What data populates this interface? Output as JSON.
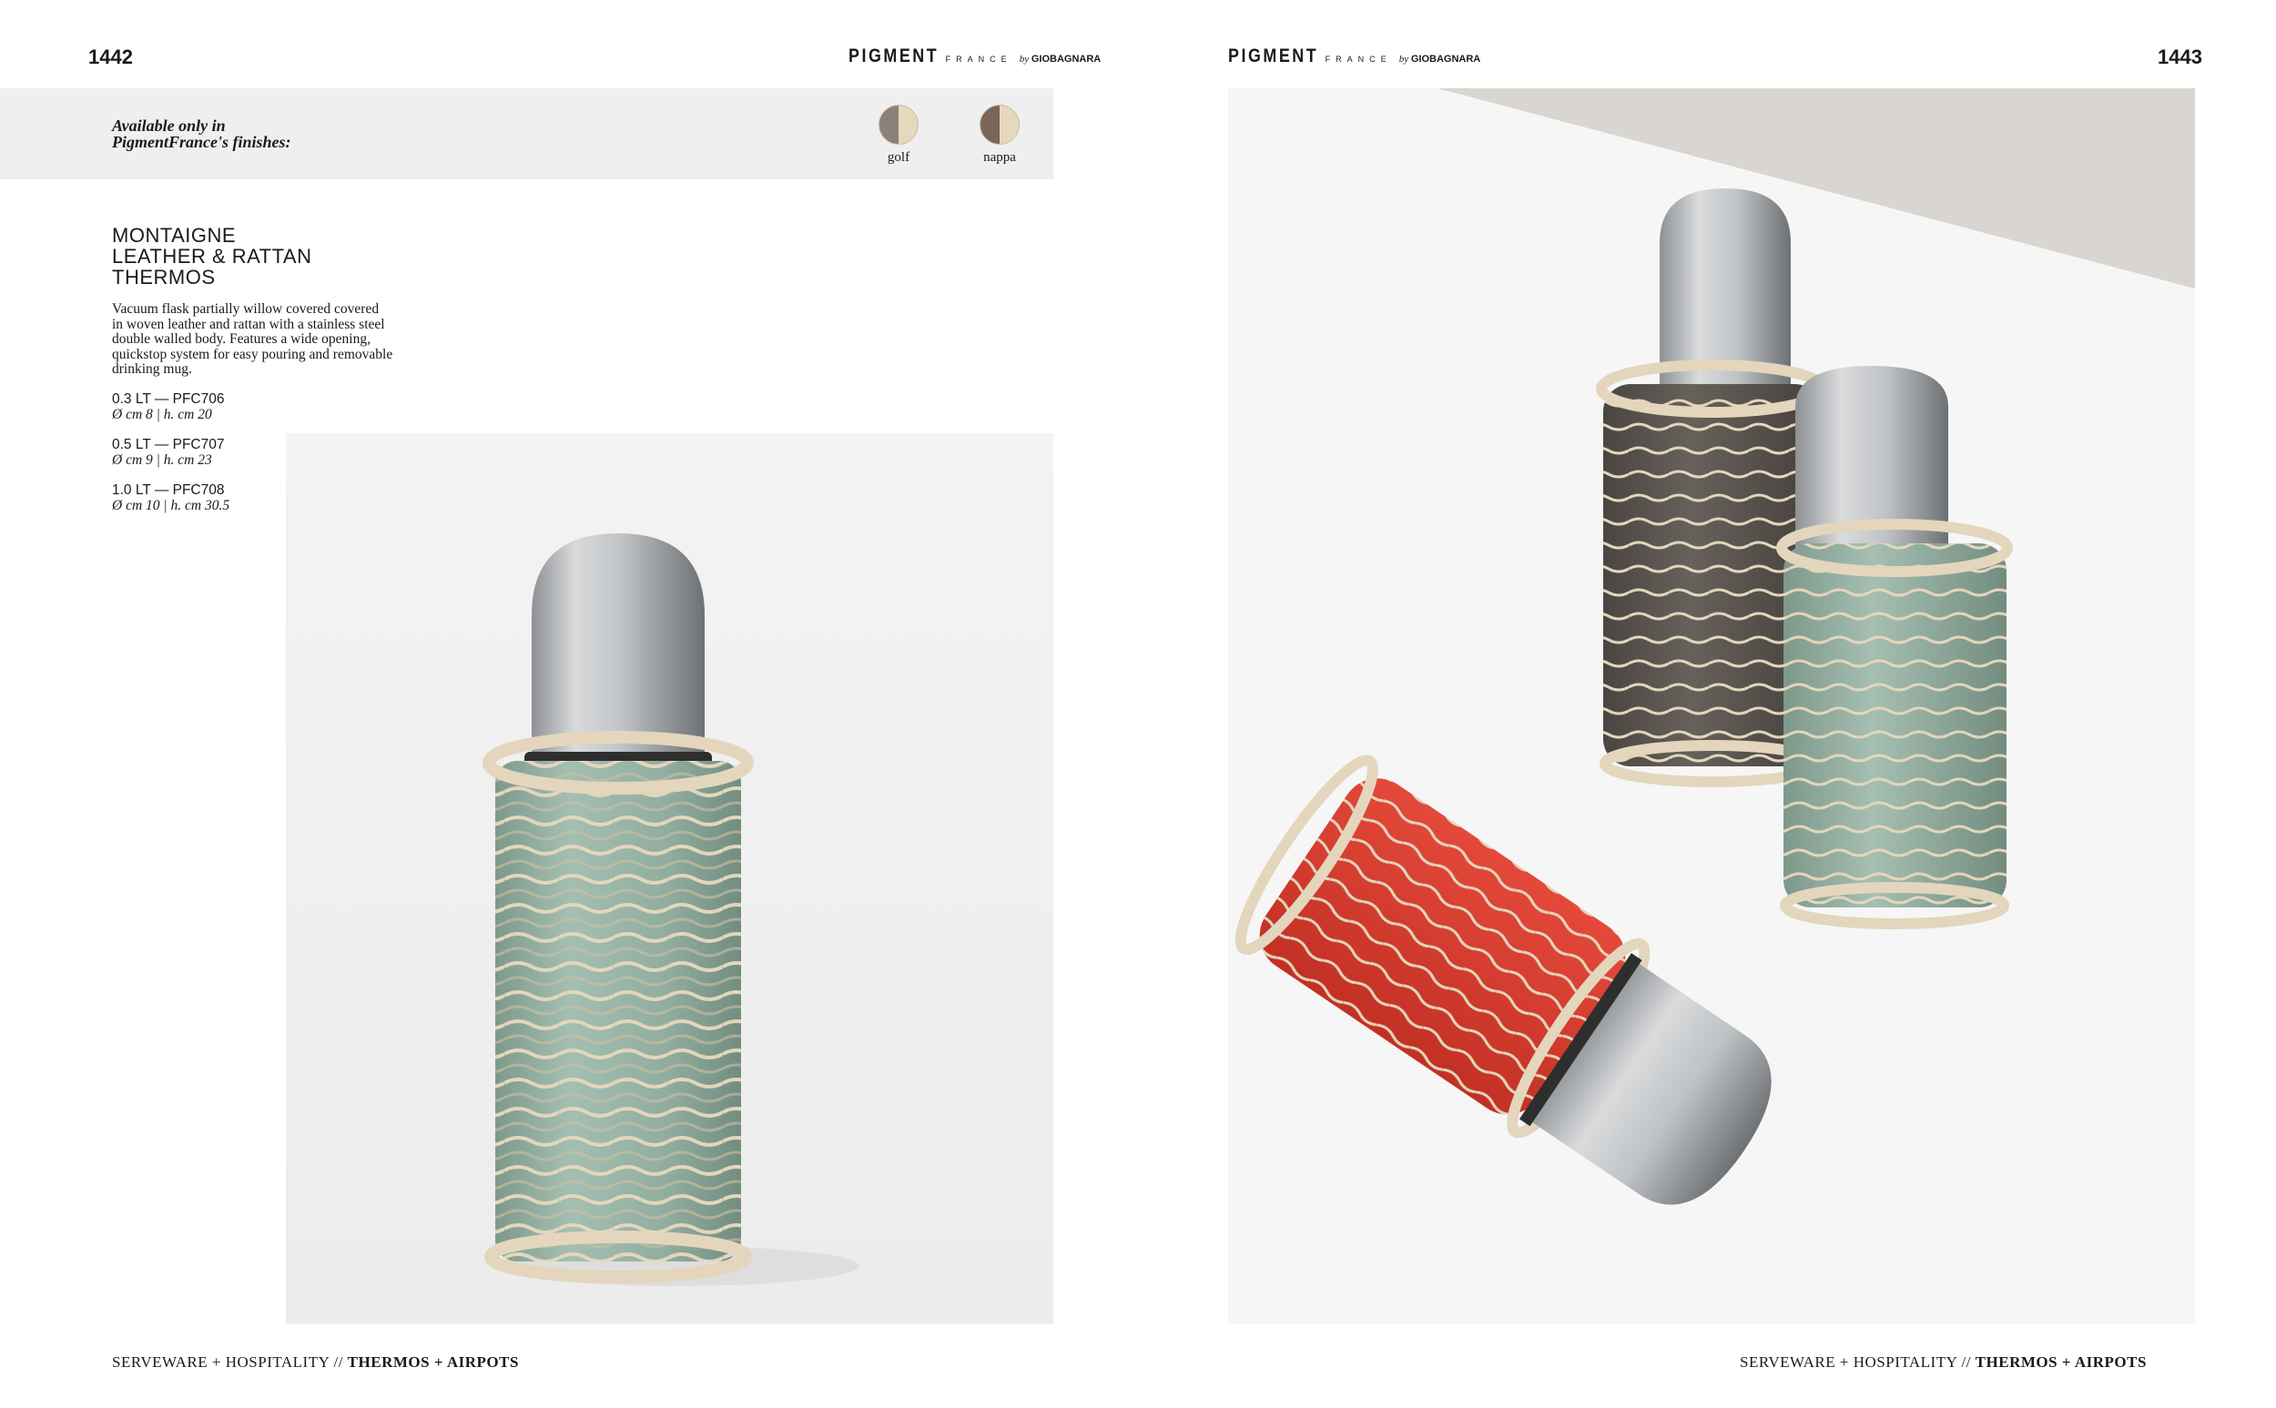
{
  "left_page": {
    "page_number": "1442",
    "brand": {
      "name": "PIGMENT",
      "sub": "FRANCE",
      "by": "by",
      "maker": "GIOBAGNARA"
    },
    "finishes": {
      "label": "Available only in PigmentFrance's finishes:",
      "label_line1": "Available only in",
      "label_line2": "PigmentFrance's finishes:",
      "items": [
        {
          "name": "golf",
          "color": "#8a8178"
        },
        {
          "name": "nappa",
          "color": "#7a6558"
        }
      ]
    },
    "product": {
      "title_line1": "MONTAIGNE",
      "title_line2": "LEATHER & RATTAN",
      "title_line3": "THERMOS",
      "description_line1": "Vacuum flask partially willow covered covered",
      "description_line2": "in woven leather and rattan with a stainless steel",
      "description_line3": "double walled body. Features a wide opening,",
      "description_line4": "quickstop system for easy pouring and removable",
      "description_line5": "drinking mug.",
      "variants": [
        {
          "code": "0.3 LT — PFC706",
          "dimensions": "Ø cm 8 | h. cm 20"
        },
        {
          "code": "0.5 LT — PFC707",
          "dimensions": "Ø cm 9 | h. cm 23"
        },
        {
          "code": "1.0 LT — PFC708",
          "dimensions": "Ø cm 10 | h. cm 30.5"
        }
      ]
    },
    "footer": {
      "section": "SERVEWARE + HOSPITALITY //",
      "category": "THERMOS + AIRPOTS"
    }
  },
  "right_page": {
    "page_number": "1443",
    "brand": {
      "name": "PIGMENT",
      "sub": "FRANCE",
      "by": "by",
      "maker": "GIOBAGNARA"
    },
    "footer": {
      "section": "SERVEWARE + HOSPITALITY //",
      "category": "THERMOS + AIRPOTS"
    }
  },
  "colors": {
    "sage_leather": "#8fada0",
    "charcoal_leather": "#5b5550",
    "red_leather": "#d63b2e",
    "rattan": "#e3d6bc",
    "steel": "#b9bcbf",
    "bar_gray": "#efefef"
  }
}
